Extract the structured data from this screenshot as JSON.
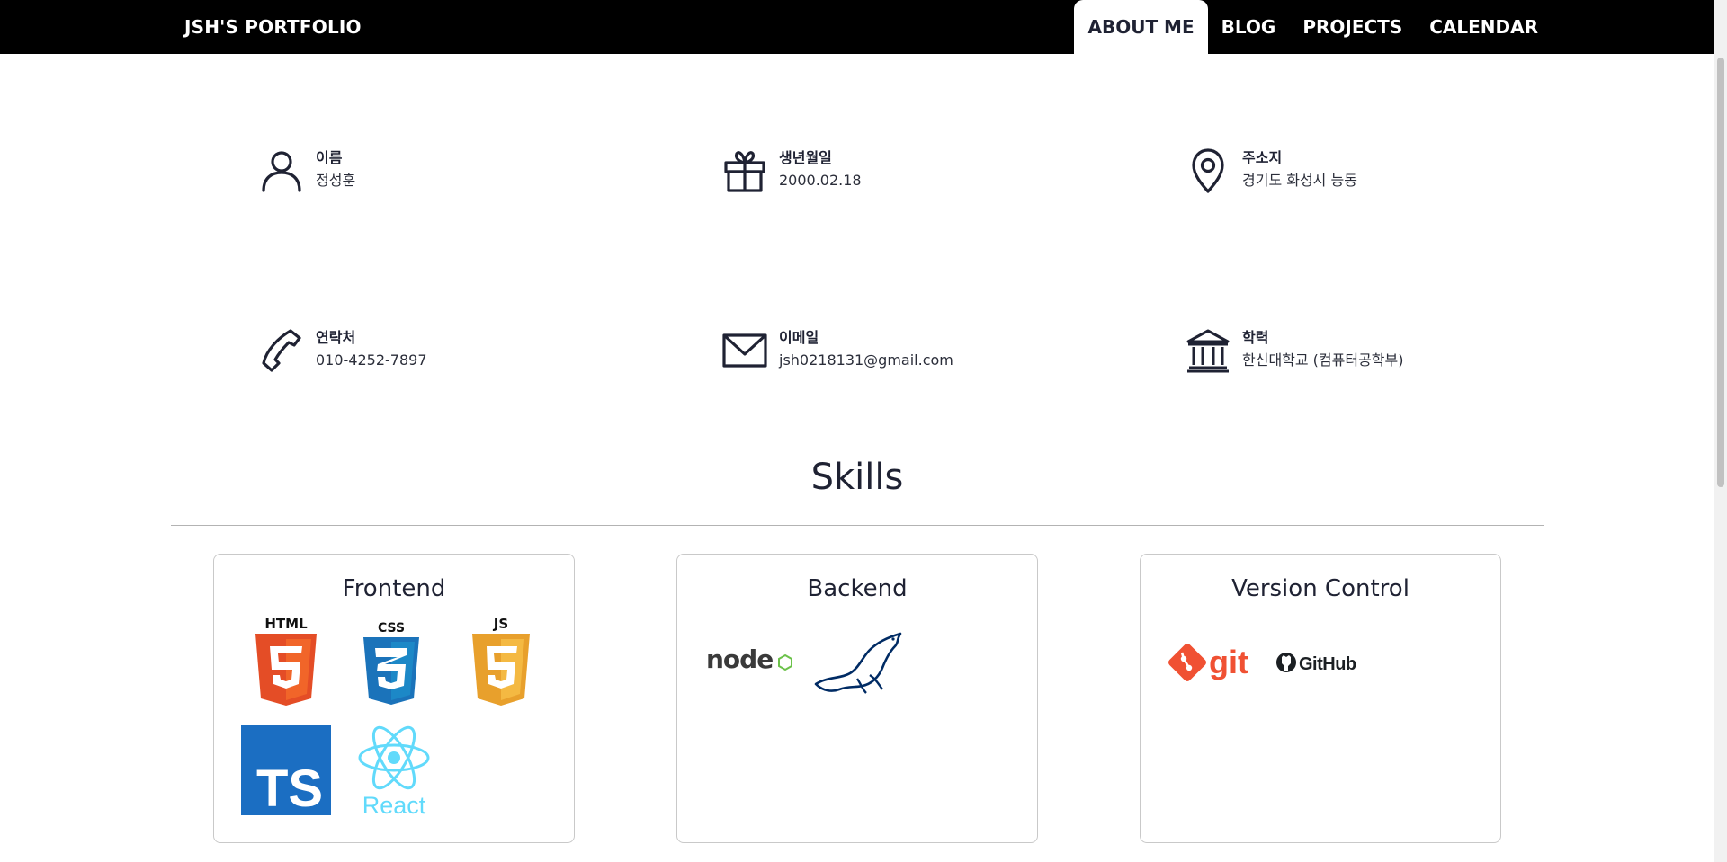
{
  "header": {
    "brand": "JSH'S PORTFOLIO",
    "nav": [
      {
        "label": "ABOUT ME",
        "active": true
      },
      {
        "label": "BLOG",
        "active": false
      },
      {
        "label": "PROJECTS",
        "active": false
      },
      {
        "label": "CALENDAR",
        "active": false
      }
    ]
  },
  "about": {
    "name": {
      "label": "이름",
      "value": "정성훈",
      "icon": "person-icon"
    },
    "birth": {
      "label": "생년월일",
      "value": "2000.02.18",
      "icon": "gift-icon"
    },
    "address": {
      "label": "주소지",
      "value": "경기도 화성시 능동",
      "icon": "location-pin-icon"
    },
    "phone": {
      "label": "연락처",
      "value": "010-4252-7897",
      "icon": "phone-icon"
    },
    "email": {
      "label": "이메일",
      "value": "jsh0218131@gmail.com",
      "icon": "envelope-icon"
    },
    "education": {
      "label": "학력",
      "value": "한신대학교 (컴퓨터공학부)",
      "icon": "institution-icon"
    }
  },
  "skills": {
    "title": "Skills",
    "categories": [
      {
        "title": "Frontend",
        "logos": [
          "HTML",
          "CSS",
          "JS",
          "TS",
          "React"
        ]
      },
      {
        "title": "Backend",
        "logos": [
          "node",
          "mariadb"
        ]
      },
      {
        "title": "Version Control",
        "logos": [
          "git",
          "GitHub"
        ]
      }
    ]
  },
  "colors": {
    "header_bg": "#000000",
    "text_dark": "#1f2233",
    "html": "#e44d26",
    "css": "#1b73ba",
    "js": "#e8a02c",
    "ts": "#1b6ec2",
    "react": "#61dafb",
    "node": "#6cc24a",
    "git": "#f05133",
    "mariadb": "#002b64"
  }
}
